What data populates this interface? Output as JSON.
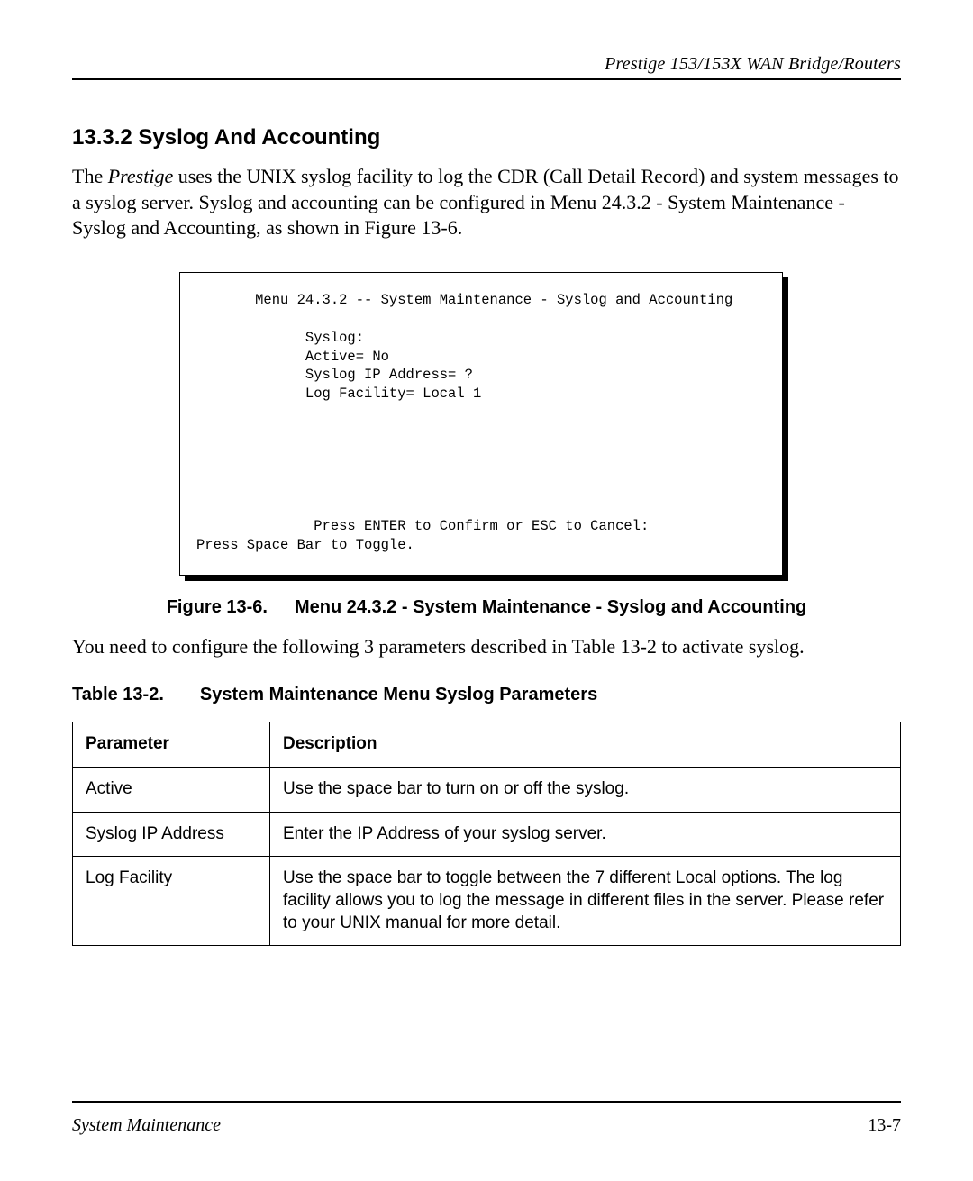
{
  "header": {
    "title": "Prestige 153/153X  WAN Bridge/Routers"
  },
  "section": {
    "heading": "13.3.2 Syslog And Accounting",
    "intro_pre": "The ",
    "intro_italic": "Prestige",
    "intro_post": " uses the UNIX syslog facility to log the CDR (Call Detail Record) and system messages to a syslog server. Syslog and accounting can be configured in Menu 24.3.2 - System Maintenance - Syslog and Accounting, as shown in Figure 13-6."
  },
  "figure": {
    "menu_title": "       Menu 24.3.2 -- System Maintenance - Syslog and Accounting",
    "lines": [
      "",
      "             Syslog:",
      "             Active= No",
      "             Syslog IP Address= ?",
      "             Log Facility= Local 1",
      "",
      "",
      "",
      "",
      "",
      "",
      "              Press ENTER to Confirm or ESC to Cancel:"
    ],
    "toggle_line": "Press Space Bar to Toggle.",
    "caption_label": "Figure 13-6.",
    "caption_text": "Menu 24.3.2 - System Maintenance - Syslog and Accounting"
  },
  "between_text": "You need to configure the following 3 parameters described in Table 13-2 to activate syslog.",
  "table": {
    "caption_label": "Table 13-2.",
    "caption_text": "System Maintenance Menu Syslog Parameters",
    "headers": {
      "param": "Parameter",
      "desc": "Description"
    },
    "rows": [
      {
        "param": "Active",
        "desc": "Use the space bar to turn on or off the syslog."
      },
      {
        "param": "Syslog IP Address",
        "desc": "Enter the IP Address of your syslog server."
      },
      {
        "param": "Log Facility",
        "desc": "Use the space bar to toggle between the 7 different Local options. The log facility allows you to log the message in different files in the server. Please refer to your UNIX manual for more detail."
      }
    ]
  },
  "footer": {
    "left": "System Maintenance",
    "right": "13-7"
  }
}
